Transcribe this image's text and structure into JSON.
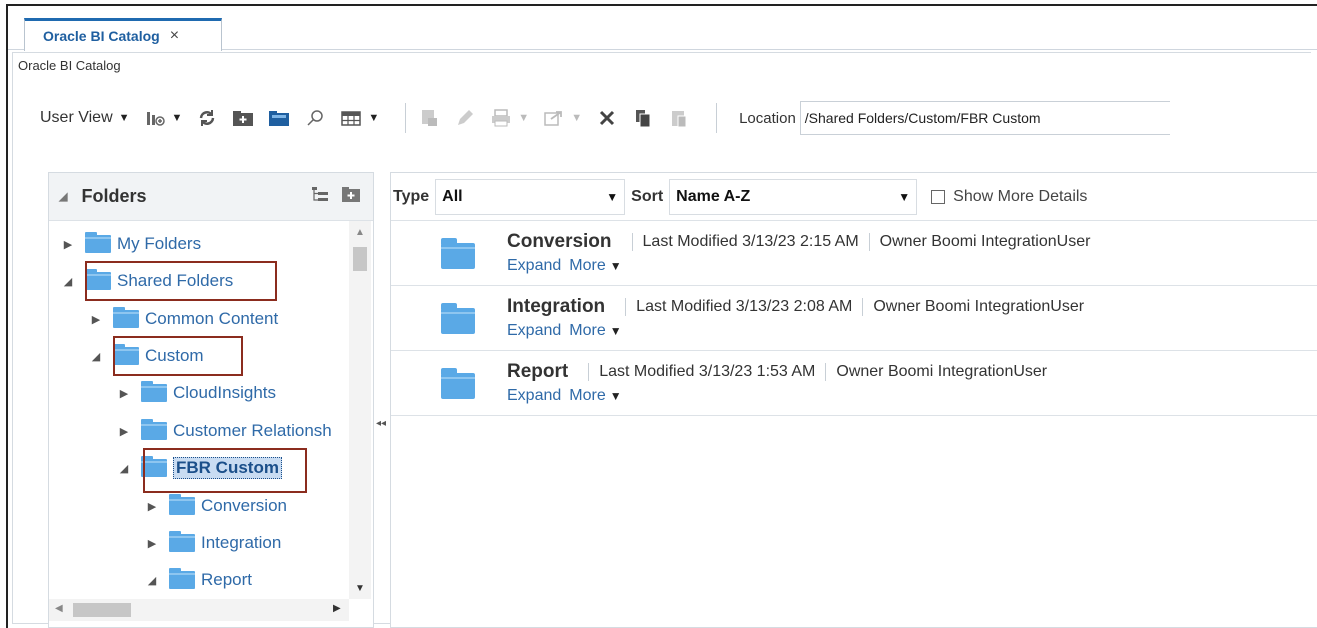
{
  "tab": {
    "title": "Oracle BI Catalog",
    "close": "×"
  },
  "breadcrumb": "Oracle BI Catalog",
  "toolbar": {
    "user_view": "User View",
    "location_label": "Location",
    "location_value": "/Shared Folders/Custom/FBR Custom"
  },
  "folders_panel": {
    "title": "Folders",
    "items": [
      {
        "label": "My Folders",
        "state": "collapsed",
        "level": 0
      },
      {
        "label": "Shared Folders",
        "state": "expanded",
        "level": 0
      },
      {
        "label": "Common Content",
        "state": "collapsed",
        "level": 1
      },
      {
        "label": "Custom",
        "state": "expanded",
        "level": 1
      },
      {
        "label": "CloudInsights",
        "state": "collapsed",
        "level": 2
      },
      {
        "label": "Customer Relationsh",
        "state": "collapsed",
        "level": 2
      },
      {
        "label": "FBR Custom",
        "state": "expanded",
        "level": 2,
        "selected": true
      },
      {
        "label": "Conversion",
        "state": "collapsed",
        "level": 3
      },
      {
        "label": "Integration",
        "state": "collapsed",
        "level": 3
      },
      {
        "label": "Report",
        "state": "expanded",
        "level": 3
      }
    ]
  },
  "filters": {
    "type_label": "Type",
    "type_value": "All",
    "sort_label": "Sort",
    "sort_value": "Name A-Z",
    "show_more": "Show More Details"
  },
  "items": [
    {
      "name": "Conversion",
      "modified": "Last Modified 3/13/23 2:15 AM",
      "owner": "Owner Boomi IntegrationUser",
      "expand": "Expand",
      "more": "More"
    },
    {
      "name": "Integration",
      "modified": "Last Modified 3/13/23 2:08 AM",
      "owner": "Owner Boomi IntegrationUser",
      "expand": "Expand",
      "more": "More"
    },
    {
      "name": "Report",
      "modified": "Last Modified 3/13/23 1:53 AM",
      "owner": "Owner Boomi IntegrationUser",
      "expand": "Expand",
      "more": "More"
    }
  ]
}
